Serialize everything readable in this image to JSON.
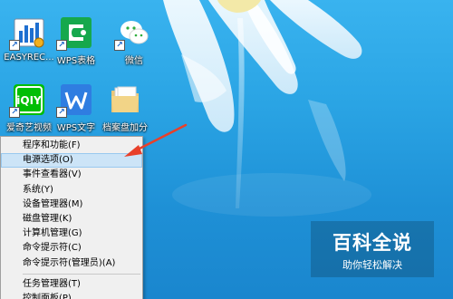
{
  "desktop": {
    "icons": [
      {
        "label": "EASYREC...",
        "icon": "easyrecovery-icon"
      },
      {
        "label": "WPS表格",
        "icon": "wps-spreadsheet-icon"
      },
      {
        "label": "微信",
        "icon": "wechat-icon"
      },
      {
        "label": "爱奇艺视频",
        "icon": "iqiyi-icon"
      },
      {
        "label": "WPS文字",
        "icon": "wps-writer-icon"
      },
      {
        "label": "档案盘加分",
        "icon": "folder-icon"
      }
    ]
  },
  "context_menu": {
    "items": [
      {
        "label": "程序和功能(F)"
      },
      {
        "label": "电源选项(O)",
        "highlighted": true
      },
      {
        "label": "事件查看器(V)"
      },
      {
        "label": "系统(Y)"
      },
      {
        "label": "设备管理器(M)"
      },
      {
        "label": "磁盘管理(K)"
      },
      {
        "label": "计算机管理(G)"
      },
      {
        "label": "命令提示符(C)"
      },
      {
        "label": "命令提示符(管理员)(A)"
      },
      {
        "label": "任务管理器(T)",
        "separator_before": true
      },
      {
        "label": "控制面板(P)"
      }
    ]
  },
  "watermark": {
    "title": "百科全说",
    "subtitle": "助你轻松解决"
  },
  "colors": {
    "annotation_arrow": "#e8402a",
    "menu_highlight": "#cce4f7"
  }
}
